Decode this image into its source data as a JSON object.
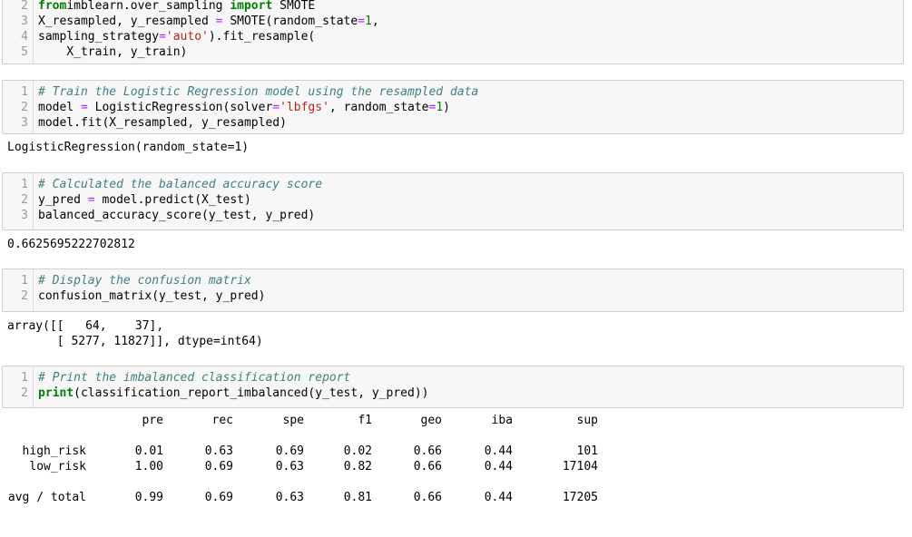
{
  "cells": {
    "c1": {
      "lines": [
        {
          "n": "2",
          "parts": [
            [
              "kw",
              "from"
            ],
            [
              "",
              "imblearn.over_sampling "
            ],
            [
              "kw",
              "import"
            ],
            [
              "",
              " SMOTE"
            ]
          ]
        },
        {
          "n": "3",
          "parts": [
            [
              "",
              "X_resampled, y_resampled "
            ],
            [
              "op",
              "="
            ],
            [
              "",
              " SMOTE(random_state"
            ],
            [
              "op",
              "="
            ],
            [
              "num",
              "1"
            ],
            [
              "",
              ","
            ]
          ]
        },
        {
          "n": "4",
          "parts": [
            [
              "",
              "sampling_strategy"
            ],
            [
              "op",
              "="
            ],
            [
              "str",
              "'auto'"
            ],
            [
              "",
              ").fit_resample("
            ]
          ]
        },
        {
          "n": "5",
          "parts": [
            [
              "",
              "    X_train, y_train)"
            ]
          ]
        }
      ]
    },
    "c2": {
      "lines": [
        {
          "n": "1",
          "parts": [
            [
              "cm",
              "# Train the Logistic Regression model using the resampled data"
            ]
          ]
        },
        {
          "n": "2",
          "parts": [
            [
              "",
              "model "
            ],
            [
              "op",
              "="
            ],
            [
              "",
              " LogisticRegression(solver"
            ],
            [
              "op",
              "="
            ],
            [
              "str",
              "'lbfgs'"
            ],
            [
              "",
              ", random_state"
            ],
            [
              "op",
              "="
            ],
            [
              "num",
              "1"
            ],
            [
              "",
              ")"
            ]
          ]
        },
        {
          "n": "3",
          "parts": [
            [
              "",
              "model.fit(X_resampled, y_resampled)"
            ]
          ]
        }
      ],
      "output": "LogisticRegression(random_state=1)"
    },
    "c3": {
      "lines": [
        {
          "n": "1",
          "parts": [
            [
              "cm",
              "# Calculated the balanced accuracy score"
            ]
          ]
        },
        {
          "n": "2",
          "parts": [
            [
              "",
              "y_pred "
            ],
            [
              "op",
              "="
            ],
            [
              "",
              " model.predict(X_test)"
            ]
          ]
        },
        {
          "n": "3",
          "parts": [
            [
              "",
              "balanced_accuracy_score(y_test, y_pred)"
            ]
          ]
        }
      ],
      "output": "0.6625695222702812"
    },
    "c4": {
      "lines": [
        {
          "n": "1",
          "parts": [
            [
              "cm",
              "# Display the confusion matrix"
            ]
          ]
        },
        {
          "n": "2",
          "parts": [
            [
              "",
              "confusion_matrix(y_test, y_pred)"
            ]
          ]
        }
      ],
      "output": "array([[   64,    37],\n       [ 5277, 11827]], dtype=int64)"
    },
    "c5": {
      "lines": [
        {
          "n": "1",
          "parts": [
            [
              "cm",
              "# Print the imbalanced classification report"
            ]
          ]
        },
        {
          "n": "2",
          "parts": [
            [
              "kw",
              "print"
            ],
            [
              "",
              "(classification_report_imbalanced(y_test, y_pred))"
            ]
          ]
        }
      ]
    }
  },
  "report": {
    "headers": [
      "pre",
      "rec",
      "spe",
      "f1",
      "geo",
      "iba",
      "sup"
    ],
    "rows": [
      {
        "label": "high_risk",
        "values": [
          "0.01",
          "0.63",
          "0.69",
          "0.02",
          "0.66",
          "0.44",
          "101"
        ]
      },
      {
        "label": "low_risk",
        "values": [
          "1.00",
          "0.69",
          "0.63",
          "0.82",
          "0.66",
          "0.44",
          "17104"
        ]
      },
      {
        "label": "",
        "values": [
          "",
          "",
          "",
          "",
          "",
          "",
          ""
        ]
      },
      {
        "label": "avg / total",
        "values": [
          "0.99",
          "0.69",
          "0.63",
          "0.81",
          "0.66",
          "0.44",
          "17205"
        ]
      }
    ]
  }
}
